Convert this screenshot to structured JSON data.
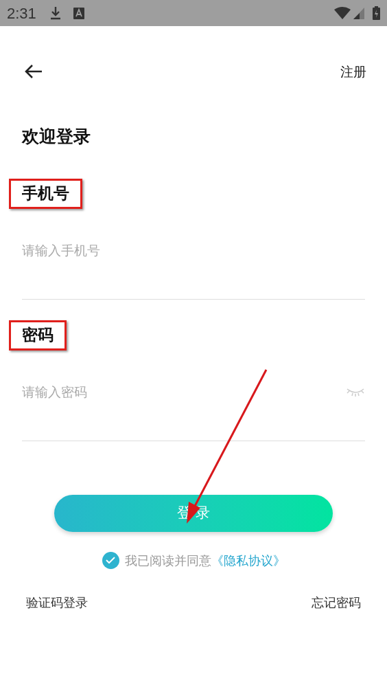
{
  "status_bar": {
    "time": "2:31"
  },
  "header": {
    "register": "注册"
  },
  "title": "欢迎登录",
  "fields": [
    {
      "kind": "phone",
      "label": "手机号",
      "placeholder": "请输入手机号",
      "annotated": true
    },
    {
      "kind": "password",
      "label": "密码",
      "placeholder": "请输入密码",
      "annotated": true
    }
  ],
  "login_button": "登 录",
  "agreement": {
    "checked": true,
    "text": "我已阅读并同意",
    "link": "《隐私协议》"
  },
  "links": [
    "验证码登录",
    "忘记密码"
  ]
}
